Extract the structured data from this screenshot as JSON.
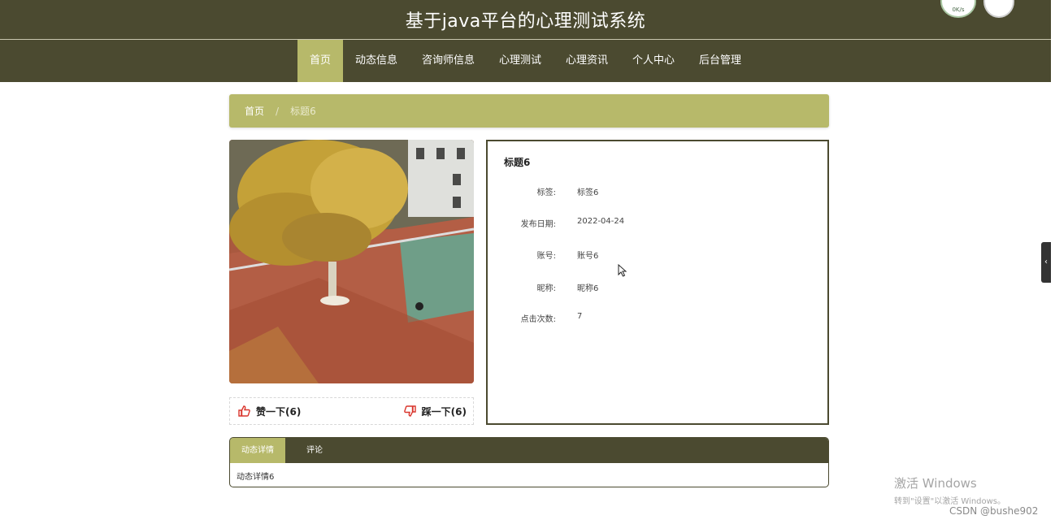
{
  "header": {
    "title": "基于java平台的心理测试系统",
    "widget_text": "0K/s"
  },
  "nav": {
    "items": [
      {
        "label": "首页",
        "active": true
      },
      {
        "label": "动态信息"
      },
      {
        "label": "咨询师信息"
      },
      {
        "label": "心理测试"
      },
      {
        "label": "心理资讯"
      },
      {
        "label": "个人中心"
      },
      {
        "label": "后台管理"
      }
    ]
  },
  "breadcrumb": {
    "home": "首页",
    "separator": "/",
    "current": "标题6"
  },
  "votes": {
    "like_label": "赞一下(6)",
    "dislike_label": "踩一下(6)"
  },
  "detail": {
    "title": "标题6",
    "fields": [
      {
        "label": "标签:",
        "value": "标签6"
      },
      {
        "label": "发布日期:",
        "value": "2022-04-24"
      },
      {
        "label": "账号:",
        "value": "账号6"
      },
      {
        "label": "昵称:",
        "value": "昵称6"
      },
      {
        "label": "点击次数:",
        "value": "7"
      }
    ]
  },
  "tabs": {
    "items": [
      {
        "label": "动态详情",
        "active": true
      },
      {
        "label": "评论"
      }
    ],
    "content": "动态详情6"
  },
  "overlay": {
    "activation_title": "激活 Windows",
    "activation_sub": "转到\"设置\"以激活 Windows。",
    "credit": "CSDN @bushe902"
  },
  "colors": {
    "header_bg": "#4b4a30",
    "accent": "#b7b96a",
    "vote_red": "#d9342b"
  }
}
